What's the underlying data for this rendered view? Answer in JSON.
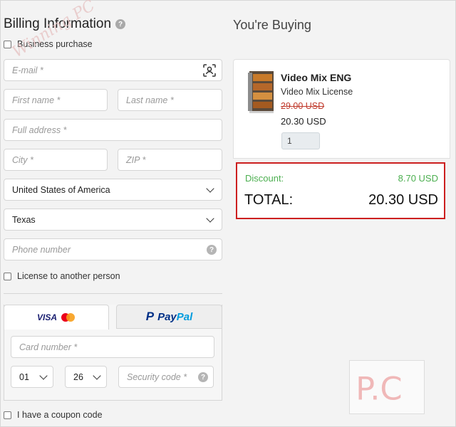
{
  "billing": {
    "title": "Billing Information",
    "help_glyph": "?",
    "business_purchase_label": "Business purchase",
    "email_placeholder": "E-mail *",
    "first_name_placeholder": "First name *",
    "last_name_placeholder": "Last name *",
    "full_address_placeholder": "Full address *",
    "city_placeholder": "City *",
    "zip_placeholder": "ZIP *",
    "country_value": "United States of America",
    "state_value": "Texas",
    "phone_placeholder": "Phone number",
    "license_other_label": "License to another person"
  },
  "payment": {
    "visa_label": "VISA",
    "paypal_mark": "P",
    "paypal_label_pay": "Pay",
    "paypal_label_pal": "Pal",
    "card_number_placeholder": "Card number *",
    "month_value": "01",
    "year_value": "26",
    "security_code_placeholder": "Security code *"
  },
  "coupon_label": "I have a coupon code",
  "cart": {
    "title": "You're Buying",
    "product_name": "Video Mix ENG",
    "license_name": "Video Mix License",
    "old_price": "29.00 USD",
    "new_price": "20.30 USD",
    "quantity": "1",
    "discount_label": "Discount:",
    "discount_value": "8.70 USD",
    "total_label": "TOTAL:",
    "total_value": "20.30 USD"
  },
  "watermark": {
    "text": "Winning PC",
    "logo_text": "P.C"
  },
  "colors": {
    "discount_green": "#4caf50",
    "old_price_red": "#c0392b",
    "highlight_border": "#cc1f1f",
    "paypal_blue": "#003087"
  }
}
